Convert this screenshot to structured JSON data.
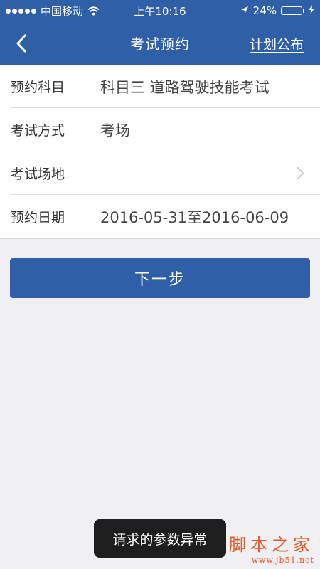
{
  "status_bar": {
    "carrier": "中国移动",
    "time": "上午10:16",
    "battery_percent": "24%",
    "battery_level": 0.24
  },
  "navbar": {
    "back_icon": "chevron-left-icon",
    "title": "考试预约",
    "right_link": "计划公布"
  },
  "form": {
    "rows": [
      {
        "label": "预约科目",
        "value": "科目三 道路驾驶技能考试"
      },
      {
        "label": "考试方式",
        "value": "考场"
      },
      {
        "label": "考试场地",
        "value": ""
      },
      {
        "label": "预约日期",
        "value": "2016-05-31至2016-06-09"
      }
    ]
  },
  "next_button": {
    "label": "下一步"
  },
  "toast": {
    "text": "请求的参数异常"
  },
  "watermark": {
    "title": "脚本之家",
    "url": "www.jb51.net"
  },
  "colors": {
    "primary": "#2f5fa7",
    "background": "#efeff4",
    "toast_bg": "#1e1e1e",
    "watermark": "#e25a26"
  }
}
